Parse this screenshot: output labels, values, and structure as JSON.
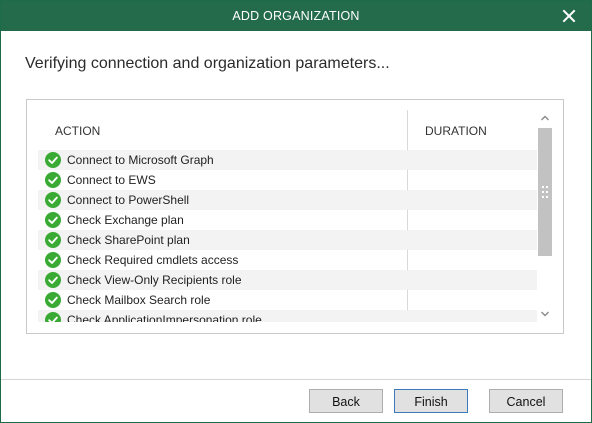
{
  "window": {
    "title": "ADD ORGANIZATION"
  },
  "heading": "Verifying connection and organization parameters...",
  "table": {
    "columns": [
      "ACTION",
      "DURATION"
    ],
    "rows": [
      {
        "action": "Connect to Microsoft Graph",
        "duration": "",
        "status": "success"
      },
      {
        "action": "Connect to EWS",
        "duration": "",
        "status": "success"
      },
      {
        "action": "Connect to PowerShell",
        "duration": "",
        "status": "success"
      },
      {
        "action": "Check Exchange plan",
        "duration": "",
        "status": "success"
      },
      {
        "action": "Check SharePoint plan",
        "duration": "",
        "status": "success"
      },
      {
        "action": "Check Required cmdlets access",
        "duration": "",
        "status": "success"
      },
      {
        "action": "Check View-Only Recipients role",
        "duration": "",
        "status": "success"
      },
      {
        "action": "Check Mailbox Search role",
        "duration": "",
        "status": "success"
      },
      {
        "action": "Check ApplicationImpersonation role",
        "duration": "",
        "status": "success"
      }
    ]
  },
  "buttons": {
    "back": "Back",
    "finish": "Finish",
    "cancel": "Cancel"
  },
  "colors": {
    "titlebar": "#236b4b",
    "success": "#3aaa35",
    "primary_border": "#3c7ab8"
  },
  "icons": {
    "close": "close-icon",
    "status": "check-circle-icon",
    "scroll_up": "chevron-up-icon",
    "scroll_down": "chevron-down-icon",
    "grip": "grip-icon"
  }
}
